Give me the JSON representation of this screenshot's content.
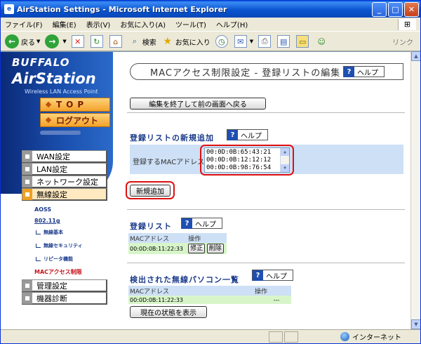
{
  "window": {
    "title": "AirStation Settings - Microsoft Internet Explorer"
  },
  "menu": [
    "ファイル(F)",
    "編集(E)",
    "表示(V)",
    "お気に入り(A)",
    "ツール(T)",
    "ヘルプ(H)"
  ],
  "toolbar": {
    "back": "戻る",
    "search": "検索",
    "favorites": "お気に入り",
    "links": "リンク"
  },
  "statusbar": {
    "zone": "インターネット"
  },
  "sidebar": {
    "brand": "BUFFALO",
    "product": "AirStation",
    "tagline": "Wireless LAN Access Point",
    "top": "TOP",
    "logout": "ログアウト",
    "nav": [
      "WAN設定",
      "LAN設定",
      "ネットワーク設定",
      "無線設定"
    ],
    "sub_aoss": "AOSS",
    "sub_80211g": "802.11g",
    "sub_items": [
      "無線基本",
      "無線セキュリティ",
      "リピータ機能"
    ],
    "sub_mac": "MACアクセス制限",
    "nav_bottom": [
      "管理設定",
      "機器診断"
    ]
  },
  "content": {
    "page_title": "MACアクセス制限設定 - 登録リストの編集",
    "help": "ヘルプ",
    "back_button": "編集を終了して前の画面へ戻る",
    "new_section": "登録リストの新規追加",
    "reg_label": "登録するMACアドレス",
    "mac_entries": [
      "00:0D:0B:65:43:21",
      "00:0D:0B:12:12:12",
      "00:0D:0B:98:76:54"
    ],
    "add_button": "新規追加",
    "reg_list_section": "登録リスト",
    "col_mac": "MACアドレス",
    "col_op": "操作",
    "reg_row": {
      "mac": "00:0D:0B:11:22:33",
      "edit": "修正",
      "delete": "削除"
    },
    "detected_section": "検出された無線パソコン一覧",
    "det_row": {
      "mac": "00:0D:0B:11:22:33",
      "op": "---"
    },
    "status_button": "現在の状態を表示"
  }
}
